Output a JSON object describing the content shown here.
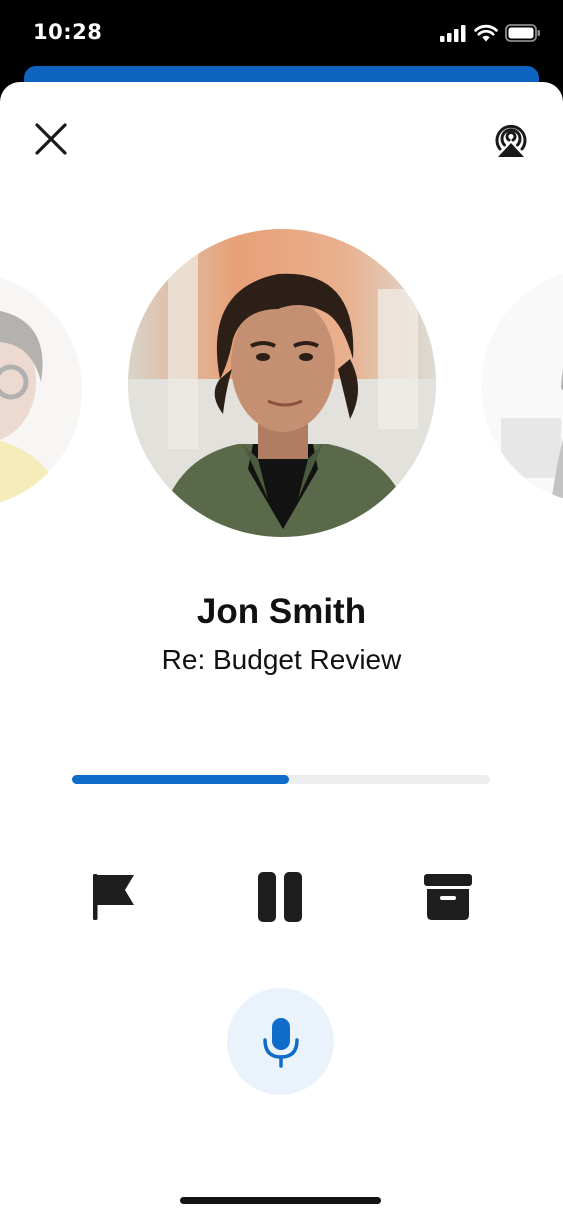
{
  "status_bar": {
    "time": "10:28"
  },
  "header": {
    "close_icon": "close-icon",
    "airplay_icon": "airplay-icon"
  },
  "playback": {
    "sender": "Jon Smith",
    "subject": "Re: Budget Review",
    "progress": 0.52
  },
  "controls": {
    "flag_icon": "flag-icon",
    "pause_icon": "pause-icon",
    "archive_icon": "archive-icon",
    "mic_icon": "microphone-icon"
  },
  "colors": {
    "accent": "#0f6cc9",
    "mic_background": "#eaf3fc",
    "track": "#eeeeee",
    "header_strip": "#0f64c0"
  }
}
